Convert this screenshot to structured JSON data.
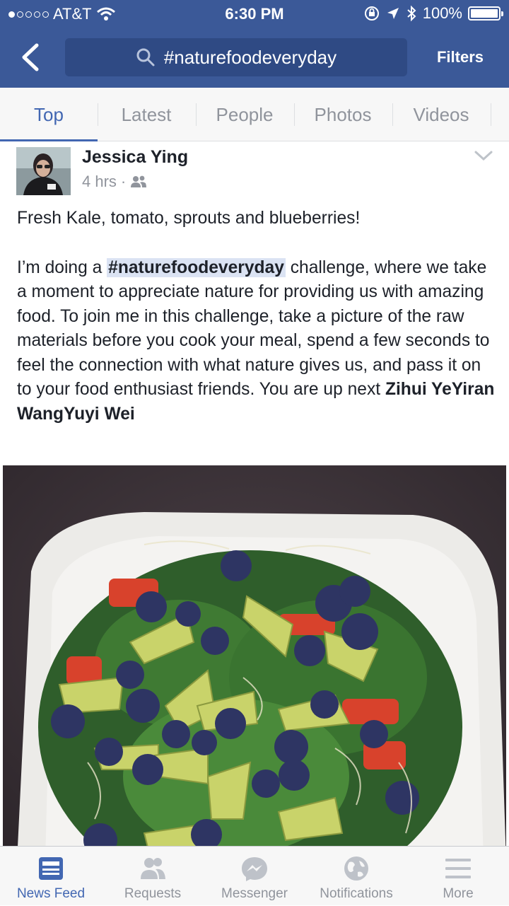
{
  "status_bar": {
    "carrier": "AT&T",
    "time": "6:30 PM",
    "battery": "100%"
  },
  "header": {
    "search_query": "#naturefoodeveryday",
    "filters_label": "Filters"
  },
  "tabs": [
    {
      "label": "Top",
      "active": true
    },
    {
      "label": "Latest"
    },
    {
      "label": "People"
    },
    {
      "label": "Photos"
    },
    {
      "label": "Videos"
    }
  ],
  "post": {
    "author": "Jessica Ying",
    "time": "4 hrs",
    "separator": "·",
    "line1": "Fresh Kale, tomato, sprouts and blueberries!",
    "text_before_hashtag": "I’m doing a ",
    "hashtag": "#naturefoodeveryday",
    "text_after_hashtag": " challenge, where we take a moment to appreciate nature for providing us with amazing food. To join me in this challenge, take a picture of the raw materials before you cook your meal, spend a few seconds to feel the connection with what nature gives us, and pass it on to your food enthusiast friends. You are up next ",
    "tag1": "Zihui Ye",
    "tag2": "Yiran Wang",
    "tag3": "Yuyi Wei"
  },
  "bottom_nav": [
    {
      "label": "News Feed",
      "icon": "news-feed-icon",
      "active": true
    },
    {
      "label": "Requests",
      "icon": "friend-requests-icon"
    },
    {
      "label": "Messenger",
      "icon": "messenger-icon"
    },
    {
      "label": "Notifications",
      "icon": "globe-icon"
    },
    {
      "label": "More",
      "icon": "menu-icon"
    }
  ],
  "colors": {
    "brand": "#3b5998",
    "accent": "#4267b2",
    "muted": "#90949c"
  }
}
